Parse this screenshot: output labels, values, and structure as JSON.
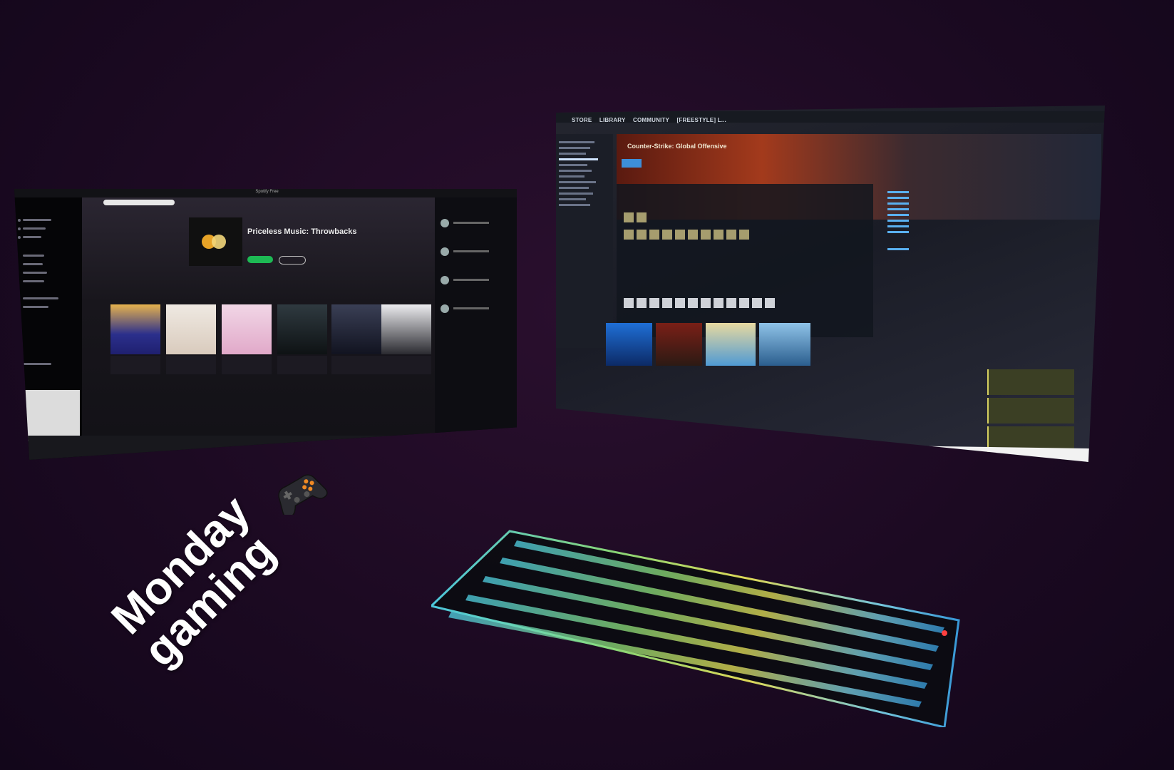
{
  "caption": {
    "line1": "Monday",
    "line2": "gaming"
  },
  "controller_icon": "gamepad-icon",
  "spotify": {
    "window_title": "Spotify Free",
    "hero_title": "Priceless Music: Throwbacks"
  },
  "steam": {
    "nav": [
      "STORE",
      "LIBRARY",
      "COMMUNITY",
      "[FREESTYLE] L..."
    ],
    "game_title": "Counter-Strike: Global Offensive"
  },
  "colors": {
    "spotify_green": "#1db954",
    "steam_blue": "#3d8fd9",
    "background": "#1c0a22",
    "caption_text": "#ffffff"
  }
}
